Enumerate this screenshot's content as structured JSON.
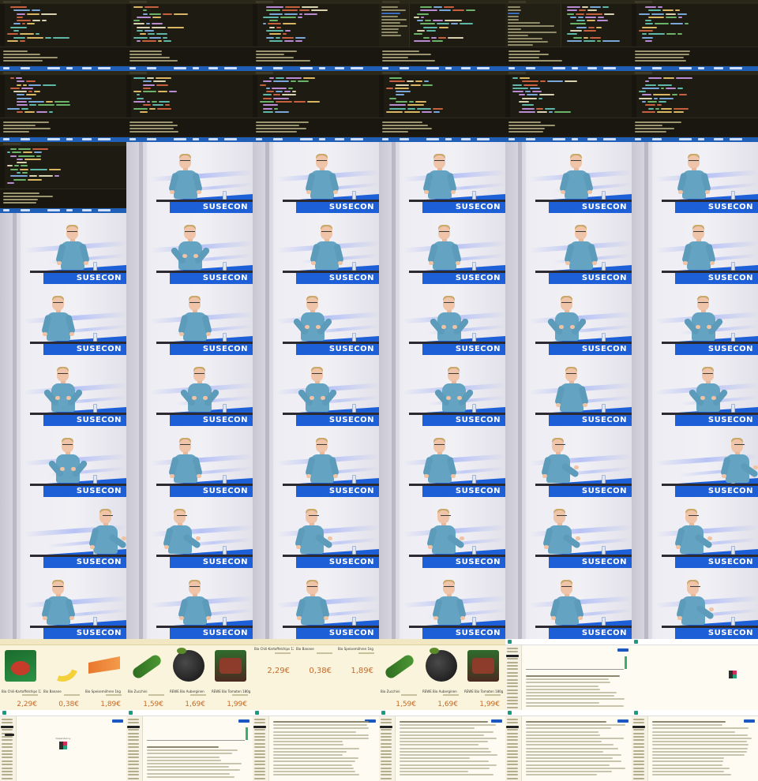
{
  "sheet": {
    "columns": 6,
    "rows": 11
  },
  "tiles": [
    {
      "kind": "code",
      "variant": "plain"
    },
    {
      "kind": "code",
      "variant": "plain"
    },
    {
      "kind": "code",
      "variant": "plain"
    },
    {
      "kind": "code",
      "variant": "sidebar"
    },
    {
      "kind": "code",
      "variant": "sidebar-wide"
    },
    {
      "kind": "code",
      "variant": "plain"
    },
    {
      "kind": "code",
      "variant": "plain"
    },
    {
      "kind": "code",
      "variant": "plain"
    },
    {
      "kind": "code",
      "variant": "plain"
    },
    {
      "kind": "code",
      "variant": "plain"
    },
    {
      "kind": "code",
      "variant": "plain"
    },
    {
      "kind": "code",
      "variant": "plain"
    },
    {
      "kind": "code",
      "variant": "plain"
    },
    {
      "kind": "talk",
      "pose": "hands-low"
    },
    {
      "kind": "talk",
      "pose": "hands-low"
    },
    {
      "kind": "talk",
      "pose": "hands-low"
    },
    {
      "kind": "talk",
      "pose": "hands-low"
    },
    {
      "kind": "talk",
      "pose": "hands-low"
    },
    {
      "kind": "talk",
      "pose": "hands-low"
    },
    {
      "kind": "talk",
      "pose": "gesture"
    },
    {
      "kind": "talk",
      "pose": "hands-low"
    },
    {
      "kind": "talk",
      "pose": "hands-low"
    },
    {
      "kind": "talk",
      "pose": "hands-low"
    },
    {
      "kind": "talk",
      "pose": "hands-low"
    },
    {
      "kind": "talk",
      "pose": "hands-low"
    },
    {
      "kind": "talk",
      "pose": "hands-low"
    },
    {
      "kind": "talk",
      "pose": "gesture"
    },
    {
      "kind": "talk",
      "pose": "gesture"
    },
    {
      "kind": "talk",
      "pose": "gesture"
    },
    {
      "kind": "talk",
      "pose": "gesture"
    },
    {
      "kind": "talk",
      "pose": "gesture"
    },
    {
      "kind": "talk",
      "pose": "gesture"
    },
    {
      "kind": "talk",
      "pose": "gesture"
    },
    {
      "kind": "talk",
      "pose": "gesture"
    },
    {
      "kind": "talk",
      "pose": "hands-low"
    },
    {
      "kind": "talk",
      "pose": "gesture"
    },
    {
      "kind": "talk",
      "pose": "gesture"
    },
    {
      "kind": "talk",
      "pose": "hands-low"
    },
    {
      "kind": "talk",
      "pose": "hands-low"
    },
    {
      "kind": "talk",
      "pose": "hands-low"
    },
    {
      "kind": "talk",
      "pose": "side"
    },
    {
      "kind": "talk",
      "pose": "side-right"
    },
    {
      "kind": "talk",
      "pose": "side-right"
    },
    {
      "kind": "talk",
      "pose": "side"
    },
    {
      "kind": "talk",
      "pose": "side"
    },
    {
      "kind": "talk",
      "pose": "side"
    },
    {
      "kind": "talk",
      "pose": "side"
    },
    {
      "kind": "talk",
      "pose": "side"
    },
    {
      "kind": "talk",
      "pose": "hands-low"
    },
    {
      "kind": "talk",
      "pose": "hands-low"
    },
    {
      "kind": "talk",
      "pose": "hands-low"
    },
    {
      "kind": "talk",
      "pose": "hands-low"
    },
    {
      "kind": "talk",
      "pose": "hands-low"
    },
    {
      "kind": "talk",
      "pose": "side"
    },
    {
      "kind": "shop",
      "variant": "row-a"
    },
    {
      "kind": "shop",
      "variant": "row-b"
    },
    {
      "kind": "shop",
      "variant": "row-c"
    },
    {
      "kind": "shop",
      "variant": "row-d"
    },
    {
      "kind": "app",
      "variant": "table-chart"
    },
    {
      "kind": "app",
      "variant": "logo"
    },
    {
      "kind": "app",
      "variant": "empty"
    },
    {
      "kind": "app",
      "variant": "table-chart"
    },
    {
      "kind": "app",
      "variant": "list"
    },
    {
      "kind": "app",
      "variant": "list"
    },
    {
      "kind": "app",
      "variant": "list"
    },
    {
      "kind": "app",
      "variant": "list"
    }
  ],
  "banner_text": "SUSECON",
  "shop": {
    "row_a": [
      {
        "name": "Bio Chili-Kartoffelchips 125g",
        "price": "2,29€",
        "img": "chips"
      },
      {
        "name": "Bio Banane",
        "price": "0,38€",
        "img": "banana"
      },
      {
        "name": "Bio Speisemöhren 1kg",
        "price": "1,89€",
        "img": "carrot"
      }
    ],
    "row_b": [
      {
        "name": "Bio Zucchini",
        "price": "1,59€",
        "img": "zucchini"
      },
      {
        "name": "REWE Bio Auberginen",
        "price": "1,69€",
        "img": "eggplant"
      },
      {
        "name": "REWE Bio Tomaten 180g",
        "price": "1,99€",
        "img": "tomato"
      }
    ],
    "row_c": [
      {
        "name": "Bio Chili-Kartoffelchips 125g",
        "price": "2,29€"
      },
      {
        "name": "Bio Banane",
        "price": "0,38€"
      },
      {
        "name": "Bio Speisemöhren 1kg",
        "price": "1,89€"
      }
    ],
    "row_c_extra": {
      "name": "Bio Zucchini",
      "price": "1,59€"
    }
  },
  "app": {
    "empty_caption": "Dependency"
  }
}
